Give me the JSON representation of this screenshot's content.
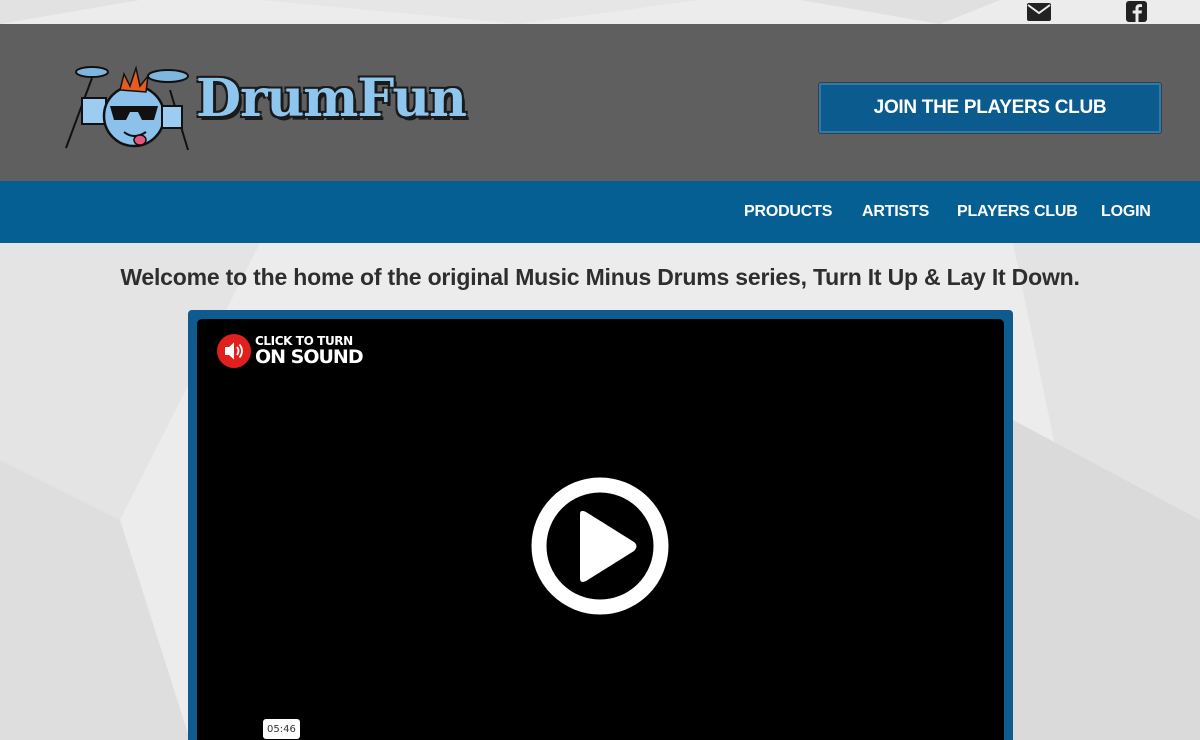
{
  "brand": {
    "logo_text": "DrumFun"
  },
  "topbar": {
    "icons": [
      "envelope-icon",
      "facebook-icon"
    ]
  },
  "header": {
    "cta_label": "JOIN THE PLAYERS CLUB"
  },
  "nav": {
    "items": [
      "PRODUCTS",
      "ARTISTS",
      "PLAYERS CLUB",
      "LOGIN"
    ]
  },
  "main": {
    "welcome_text": "Welcome to the home of the original Music Minus Drums series, Turn It Up & Lay It Down."
  },
  "video": {
    "sound_line1": "CLICK TO TURN",
    "sound_line2": "ON SOUND",
    "duration": "05:46"
  },
  "colors": {
    "header_bg": "#5f5f5f",
    "nav_bg": "#065f92",
    "button_bg": "#0b5b8f",
    "video_frame": "#0f5a8f",
    "sound_red": "#e0201c"
  }
}
